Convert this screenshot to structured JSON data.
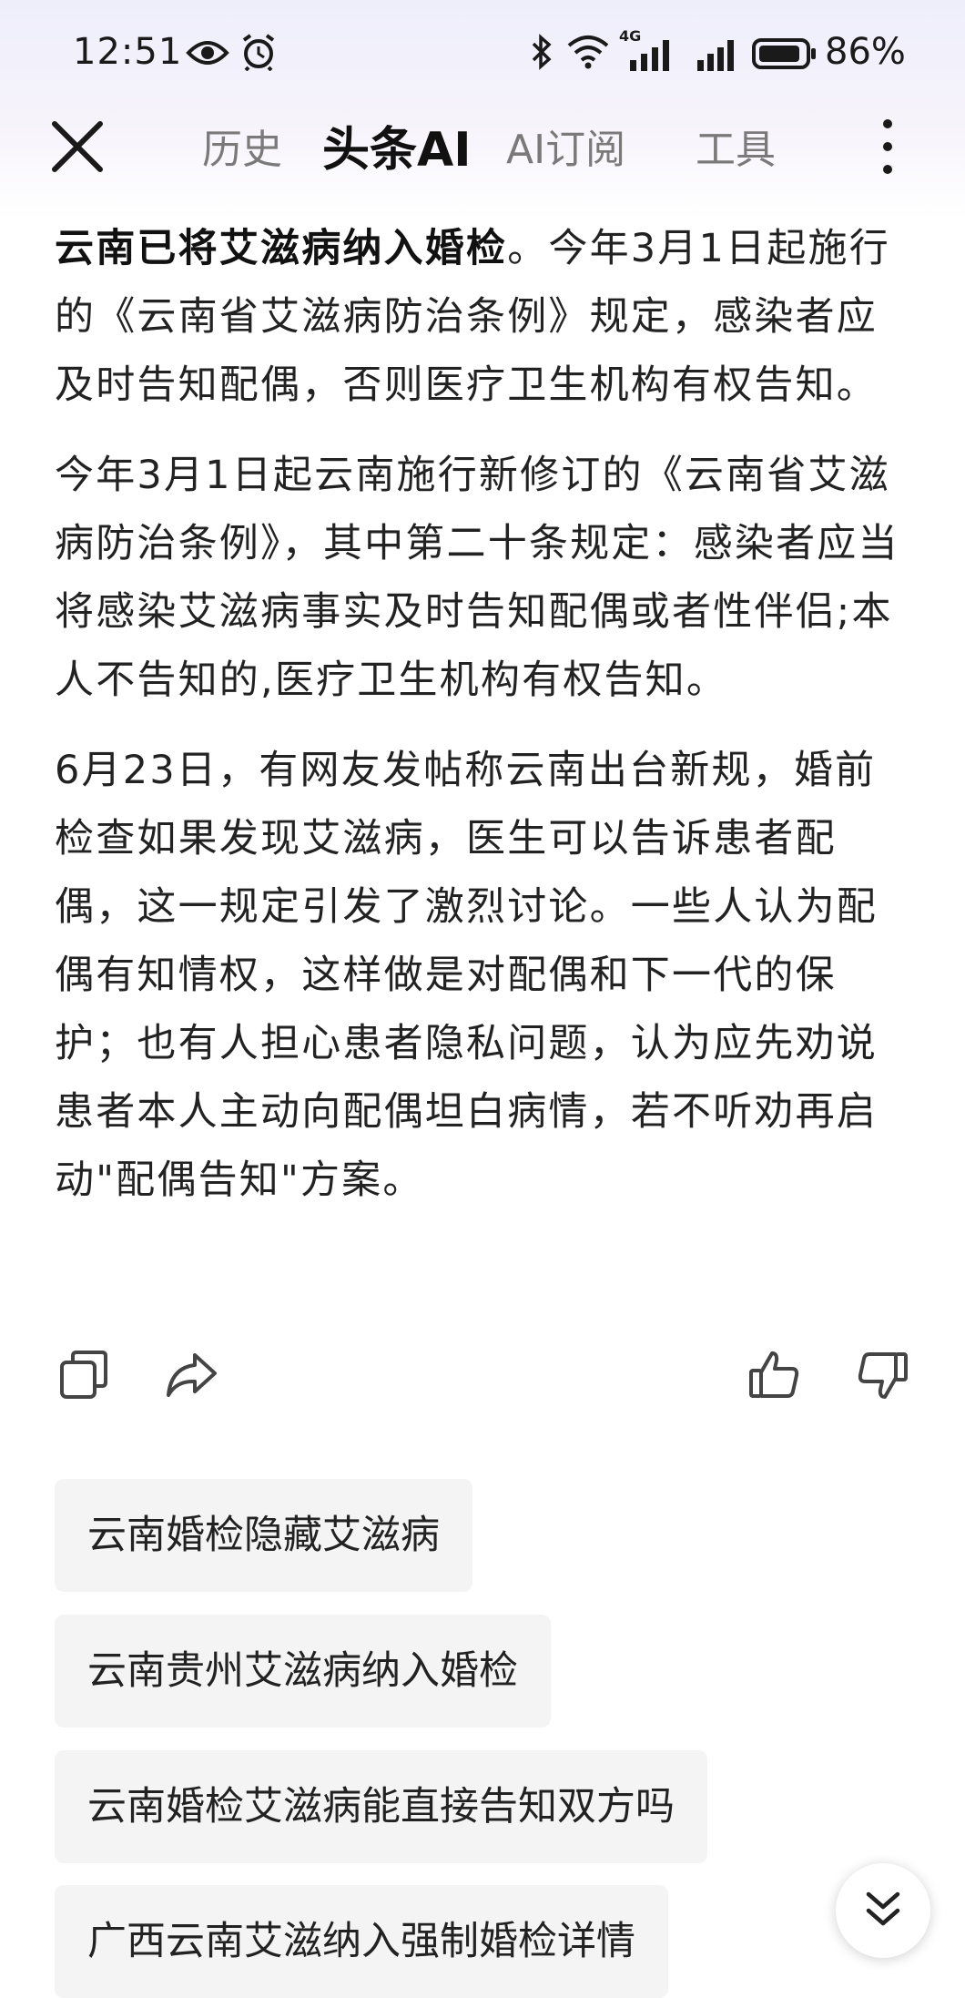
{
  "status_bar": {
    "time": "12:51",
    "network_label": "4G",
    "battery": "86%"
  },
  "nav": {
    "tabs": [
      {
        "label": "历史",
        "active": false
      },
      {
        "label": "头条AI",
        "active": true
      },
      {
        "label": "AI订阅",
        "active": false
      },
      {
        "label": "工具",
        "active": false
      }
    ]
  },
  "article": {
    "p1_bold": "云南已将艾滋病纳入婚检",
    "p1_rest": "。今年3月1日起施行的《云南省艾滋病防治条例》规定，感染者应及时告知配偶，否则医疗卫生机构有权告知。",
    "p2": "今年3月1日起云南施行新修订的《云南省艾滋病防治条例》，其中第二十条规定：感染者应当将感染艾滋病事实及时告知配偶或者性伴侣;本人不告知的,医疗卫生机构有权告知。",
    "p3": "6月23日，有网友发帖称云南出台新规，婚前检查如果发现艾滋病，医生可以告诉患者配偶，这一规定引发了激烈讨论。一些人认为配偶有知情权，这样做是对配偶和下一代的保护；也有人担心患者隐私问题，认为应先劝说患者本人主动向配偶坦白病情，若不听劝再启动\"配偶告知\"方案。"
  },
  "actions": {
    "copy": "copy-icon",
    "share": "share-icon",
    "like": "thumbs-up-icon",
    "dislike": "thumbs-down-icon"
  },
  "suggestions": [
    "云南婚检隐藏艾滋病",
    "云南贵州艾滋病纳入婚检",
    "云南婚检艾滋病能直接告知双方吗",
    "广西云南艾滋纳入强制婚检详情"
  ],
  "colors": {
    "text": "#222222",
    "muted": "#7a7a7a",
    "icon": "#444444",
    "chip_bg": "#f4f4f5"
  }
}
